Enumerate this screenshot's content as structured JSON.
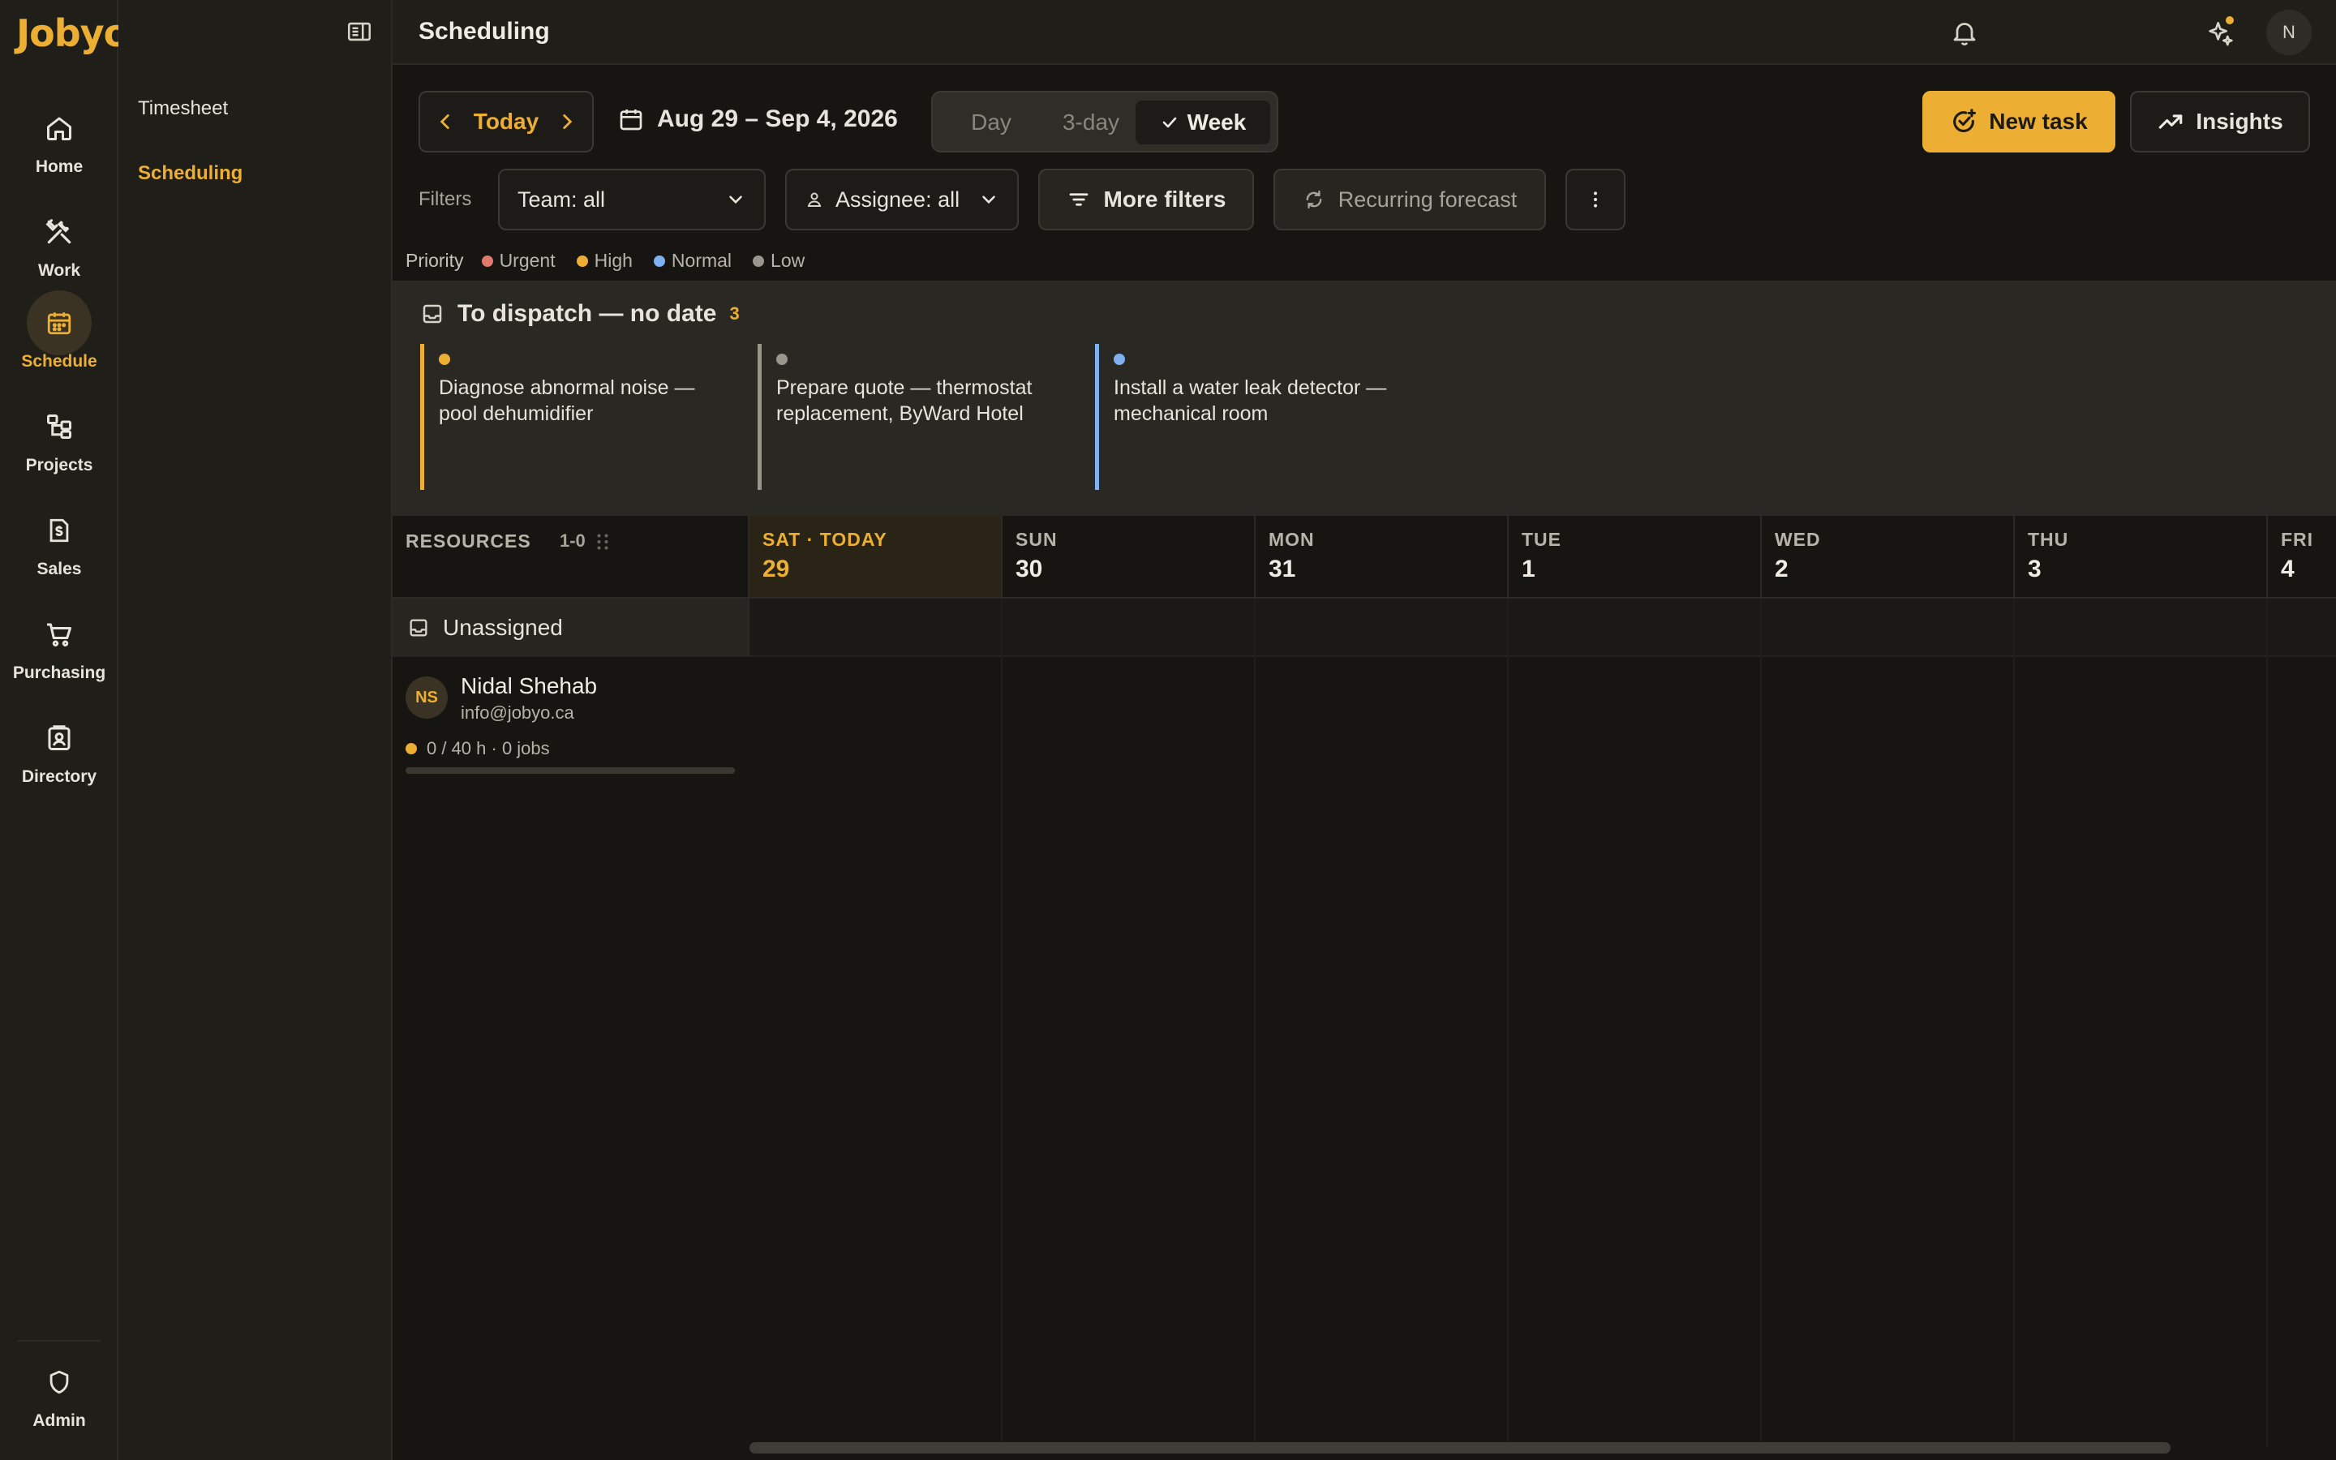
{
  "app": {
    "logo": "Jobyo"
  },
  "rail": {
    "items": [
      {
        "label": "Home",
        "icon": "home-icon"
      },
      {
        "label": "Work",
        "icon": "tools-icon"
      },
      {
        "label": "Schedule",
        "icon": "calendar-icon",
        "active": true
      },
      {
        "label": "Projects",
        "icon": "hierarchy-icon"
      },
      {
        "label": "Sales",
        "icon": "invoice-icon"
      },
      {
        "label": "Purchasing",
        "icon": "cart-icon"
      },
      {
        "label": "Directory",
        "icon": "contacts-icon"
      }
    ],
    "admin": {
      "label": "Admin",
      "icon": "shield-icon"
    }
  },
  "subnav": {
    "items": [
      {
        "label": "Timesheet"
      },
      {
        "label": "Scheduling",
        "active": true
      }
    ]
  },
  "topbar": {
    "title": "Scheduling",
    "avatar_initial": "N"
  },
  "toolbar": {
    "today_label": "Today",
    "date_range": "Aug 29 – Sep 4, 2026",
    "views": [
      {
        "label": "Day"
      },
      {
        "label": "3-day"
      },
      {
        "label": "Week",
        "active": true
      }
    ],
    "new_task_label": "New task",
    "insights_label": "Insights"
  },
  "filters": {
    "label": "Filters",
    "team": "Team: all",
    "assignee": "Assignee: all",
    "more_filters": "More filters",
    "recurring_forecast": "Recurring forecast"
  },
  "priority_legend": {
    "title": "Priority",
    "items": [
      {
        "label": "Urgent",
        "color": "#e07a6e"
      },
      {
        "label": "High",
        "color": "#ecaf34"
      },
      {
        "label": "Normal",
        "color": "#7fb0f0"
      },
      {
        "label": "Low",
        "color": "#9a968c"
      }
    ]
  },
  "dispatch": {
    "title": "To dispatch — no date",
    "count": "3",
    "cards": [
      {
        "text": "Diagnose abnormal noise — pool dehumidifier",
        "color": "#ecaf34"
      },
      {
        "text": "Prepare quote — thermostat replacement, ByWard Hotel",
        "color": "#9a968c"
      },
      {
        "text": "Install a water leak detector — mechanical room",
        "color": "#7fb0f0"
      }
    ]
  },
  "grid": {
    "resources_label": "RESOURCES",
    "size_label": "1-0",
    "days": [
      {
        "name": "SAT · TODAY",
        "num": "29",
        "today": true
      },
      {
        "name": "SUN",
        "num": "30"
      },
      {
        "name": "MON",
        "num": "31"
      },
      {
        "name": "TUE",
        "num": "1"
      },
      {
        "name": "WED",
        "num": "2"
      },
      {
        "name": "THU",
        "num": "3"
      },
      {
        "name": "FRI",
        "num": "4"
      }
    ],
    "unassigned_label": "Unassigned",
    "resources": [
      {
        "initials": "NS",
        "name": "Nidal Shehab",
        "email": "info@jobyo.ca",
        "capacity": "0 / 40 h · 0 jobs",
        "load": 0
      }
    ]
  }
}
